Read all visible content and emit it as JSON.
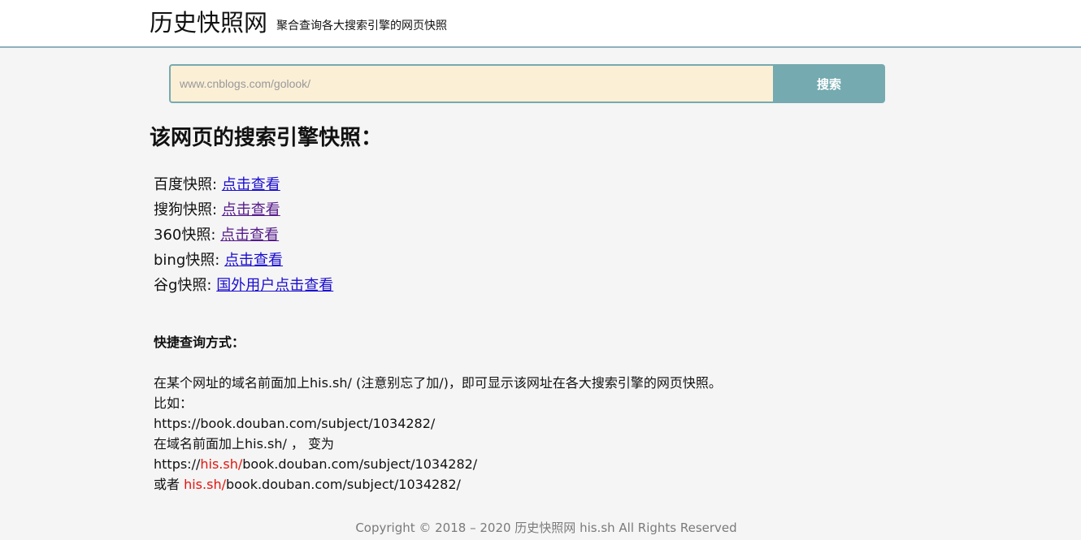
{
  "header": {
    "title": "历史快照网",
    "subtitle": "聚合查询各大搜索引擎的网页快照"
  },
  "search": {
    "placeholder": "www.cnblogs.com/golook/",
    "value": "",
    "button_label": "搜索"
  },
  "section_title": "该网页的搜索引擎快照：",
  "snapshots": [
    {
      "label": "百度快照:",
      "link": "点击查看"
    },
    {
      "label": "搜狗快照:",
      "link": "点击查看"
    },
    {
      "label": "360快照:",
      "link": "点击查看"
    },
    {
      "label": "bing快照:",
      "link": "点击查看"
    },
    {
      "label": "谷g快照:",
      "link": "国外用户点击查看"
    }
  ],
  "howto": {
    "title": "快捷查询方式：",
    "line1": "在某个网址的域名前面加上his.sh/ (注意别忘了加/)，即可显示该网址在各大搜索引擎的网页快照。",
    "line2": "比如：",
    "line3": "https://book.douban.com/subject/1034282/",
    "line4": "在域名前面加上his.sh/ ，  变为",
    "line5_prefix": "https://",
    "line5_highlight": "his.sh/",
    "line5_suffix": "book.douban.com/subject/1034282/",
    "line6_prefix": "或者 ",
    "line6_highlight": "his.sh/",
    "line6_suffix": "book.douban.com/subject/1034282/"
  },
  "footer": "Copyright © 2018 – 2020 历史快照网 his.sh All Rights Reserved",
  "colors": {
    "accent": "#74aab0",
    "input_bg": "#fbefd6",
    "link": "#1a0dcf",
    "link_visited": "#551a8b",
    "highlight": "#e3140d"
  }
}
